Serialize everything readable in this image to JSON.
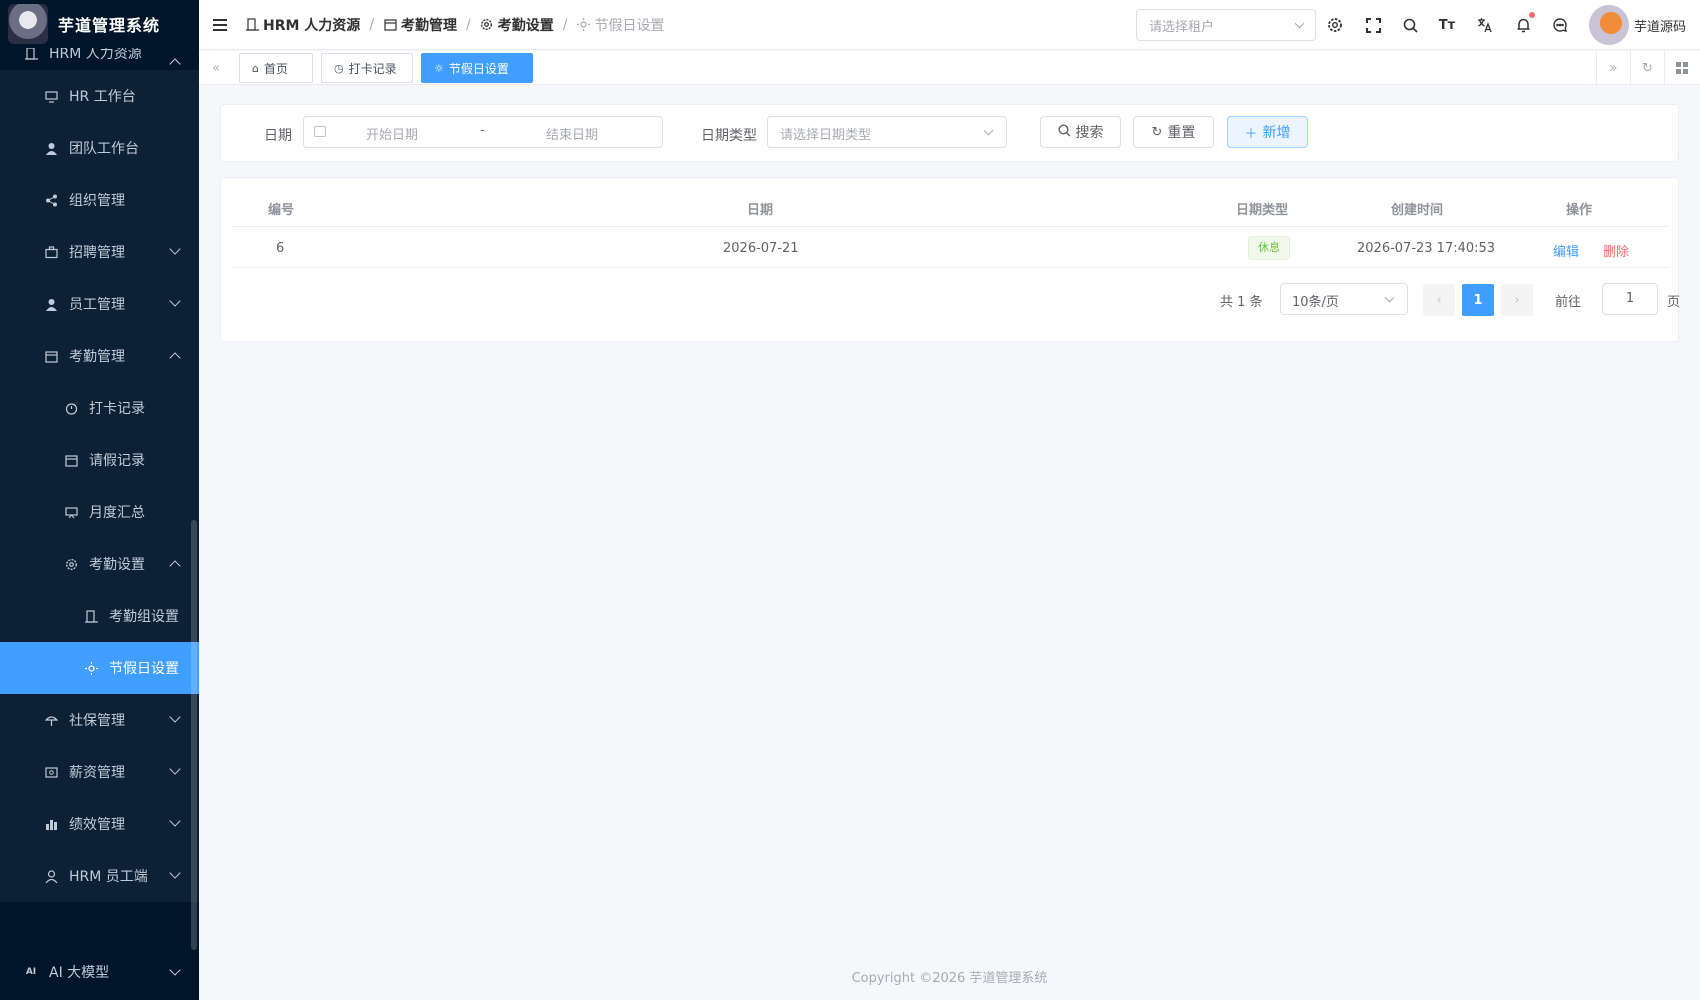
{
  "app": {
    "title": "芋道管理系统"
  },
  "sidebar": {
    "hrm": "HRM 人力资源",
    "hr_workbench": "HR 工作台",
    "team_workbench": "团队工作台",
    "org": "组织管理",
    "recruit": "招聘管理",
    "employee": "员工管理",
    "attendance": "考勤管理",
    "clockin": "打卡记录",
    "leave": "请假记录",
    "monthly": "月度汇总",
    "attendance_settings": "考勤设置",
    "attendance_group": "考勤组设置",
    "holiday": "节假日设置",
    "social": "社保管理",
    "salary": "薪资管理",
    "performance": "绩效管理",
    "hrm_employee_side": "HRM 员工端",
    "ai": "AI 大模型"
  },
  "header": {
    "breadcrumb": [
      "HRM 人力资源",
      "考勤管理",
      "考勤设置",
      "节假日设置"
    ],
    "tenant_placeholder": "请选择租户",
    "username": "芋道源码"
  },
  "tags": [
    {
      "label": "首页"
    },
    {
      "label": "打卡记录"
    },
    {
      "label": "节假日设置"
    }
  ],
  "search": {
    "date_label": "日期",
    "start_placeholder": "开始日期",
    "range_sep": "-",
    "end_placeholder": "结束日期",
    "type_label": "日期类型",
    "type_placeholder": "请选择日期类型",
    "search_btn": "搜索",
    "reset_btn": "重置",
    "add_btn": "新增"
  },
  "table": {
    "columns": [
      "编号",
      "日期",
      "日期类型",
      "创建时间",
      "操作"
    ],
    "rows": [
      {
        "id": "6",
        "date": "2026-07-21",
        "type": "休息",
        "created": "2026-07-23 17:40:53",
        "edit": "编辑",
        "delete": "删除"
      }
    ]
  },
  "pagination": {
    "total": "共 1 条",
    "page_size": "10条/页",
    "current": "1",
    "goto_label": "前往",
    "goto_value": "1",
    "page_suffix": "页"
  },
  "footer": {
    "copyright": "Copyright ©2026 芋道管理系统"
  },
  "colors": {
    "primary": "#409eff",
    "sidebar_bg": "#001529",
    "danger": "#f56c6c",
    "success": "#67c23a"
  }
}
